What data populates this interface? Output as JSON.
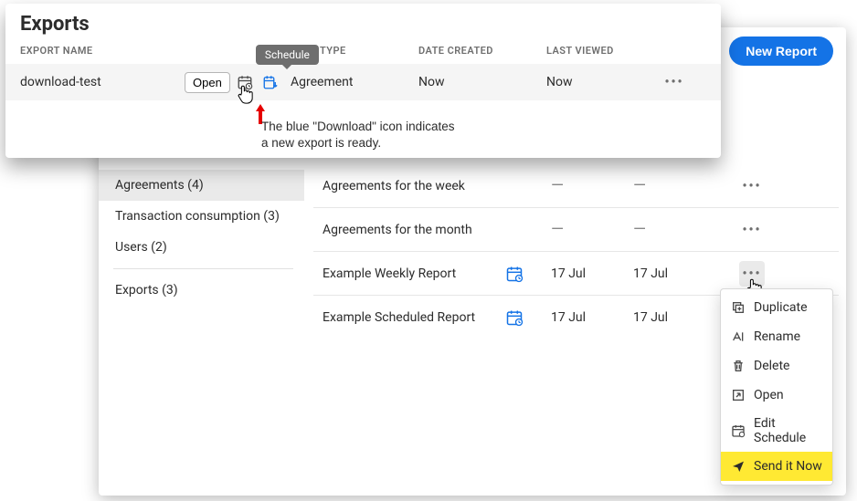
{
  "exports_panel": {
    "title": "Exports",
    "headers": {
      "name": "EXPORT NAME",
      "type": "DATA TYPE",
      "created": "DATE CREATED",
      "viewed": "LAST VIEWED"
    },
    "row": {
      "name": "download-test",
      "open_label": "Open",
      "type": "Agreement",
      "created": "Now",
      "viewed": "Now"
    },
    "tooltip": "Schedule",
    "annotation_line1": "The blue \"Download\" icon indicates",
    "annotation_line2": "a new export is ready."
  },
  "new_report": "New Report",
  "sidebar": {
    "items": [
      {
        "label": "Agreements (4)",
        "active": true
      },
      {
        "label": "Transaction consumption (3)",
        "active": false
      },
      {
        "label": "Users (2)",
        "active": false
      }
    ],
    "exports_item": "Exports (3)"
  },
  "reports": [
    {
      "name": "Agreements for the week",
      "scheduled": false,
      "date1": "—",
      "date2": "—"
    },
    {
      "name": "Agreements for the month",
      "scheduled": false,
      "date1": "—",
      "date2": "—"
    },
    {
      "name": "Example Weekly Report",
      "scheduled": true,
      "date1": "17 Jul",
      "date2": "17 Jul",
      "menu_open": true
    },
    {
      "name": "Example Scheduled Report",
      "scheduled": true,
      "date1": "17 Jul",
      "date2": "17 Jul"
    }
  ],
  "context_menu": [
    {
      "label": "Duplicate",
      "icon": "duplicate"
    },
    {
      "label": "Rename",
      "icon": "rename"
    },
    {
      "label": "Delete",
      "icon": "delete"
    },
    {
      "label": "Open",
      "icon": "open"
    },
    {
      "label": "Edit Schedule",
      "icon": "schedule"
    },
    {
      "label": "Send it Now",
      "icon": "send",
      "highlight": true
    }
  ]
}
